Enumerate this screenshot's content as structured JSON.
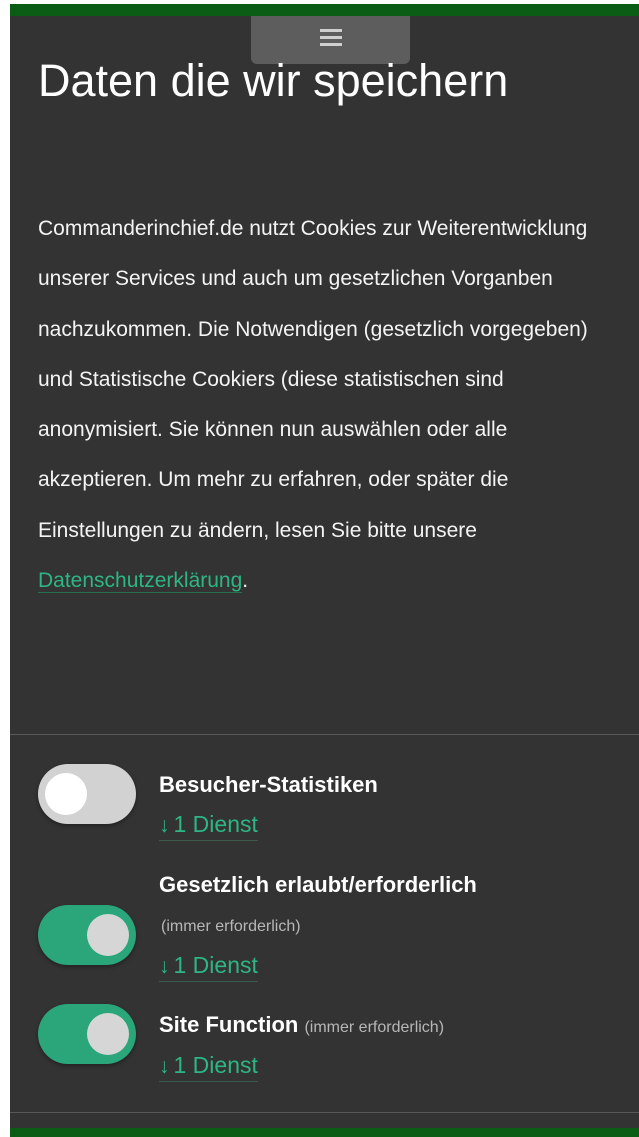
{
  "colors": {
    "panel_bg": "#333333",
    "accent": "#2db683",
    "toggle_on": "#2aa67a",
    "toggle_off": "#d2d2d2",
    "brand_strip": "#0b5c14"
  },
  "menu": {
    "icon": "hamburger-menu-icon"
  },
  "modal": {
    "title": "Daten die wir speichern",
    "intro_text": "Commanderinchief.de nutzt Cookies zur Weiterentwicklung unserer Services und auch um gesetzlichen Vorganben nachzukommen. Die Notwendigen (gesetzlich vorgegeben) und Statistische Cookiers (diese statistischen sind anonymisiert. Sie können nun auswählen oder alle akzeptieren. Um mehr zu erfahren, oder später die Einstellungen zu ändern, lesen Sie bitte unsere ",
    "privacy_link": "Datenschutzerklärung",
    "intro_end": "."
  },
  "categories": [
    {
      "title": "Besucher-Statistiken",
      "note": "",
      "service_arrow": "↓",
      "service_label": "1 Dienst",
      "enabled": false
    },
    {
      "title": "Gesetzlich erlaubt/erforderlich",
      "note": "(immer erforderlich)",
      "service_arrow": "↓",
      "service_label": "1 Dienst",
      "enabled": true
    },
    {
      "title": "Site Function",
      "note": "(immer erforderlich)",
      "service_arrow": "↓",
      "service_label": "1 Dienst",
      "enabled": true
    }
  ]
}
